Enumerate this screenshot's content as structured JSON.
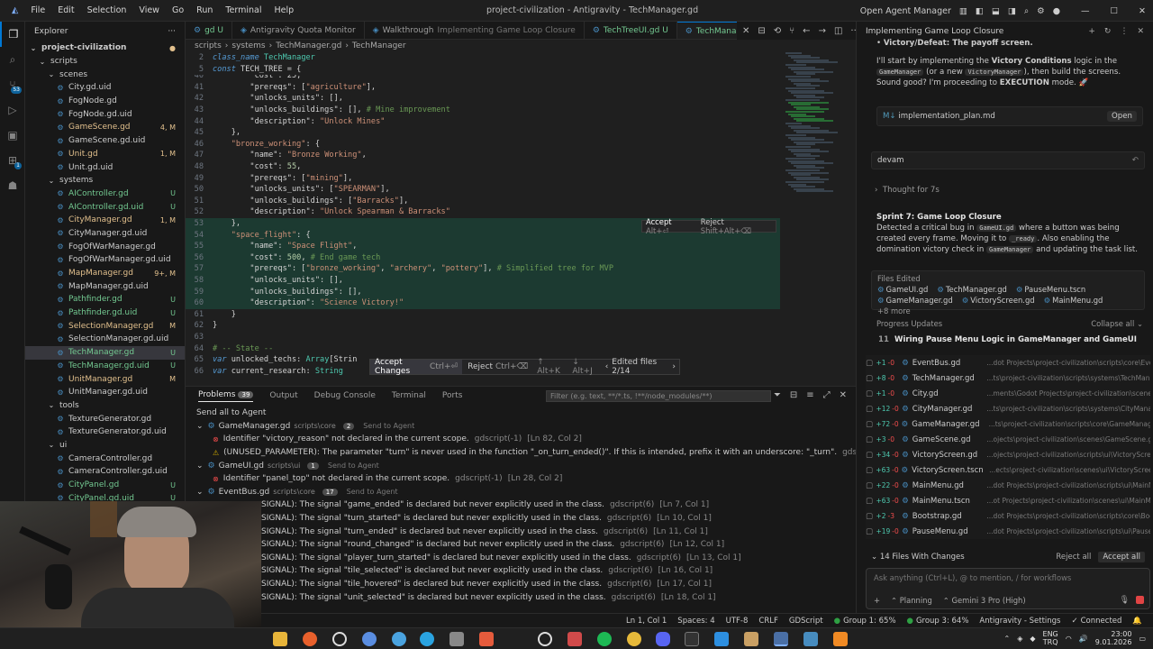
{
  "menu": [
    "File",
    "Edit",
    "Selection",
    "View",
    "Go",
    "Run",
    "Terminal",
    "Help"
  ],
  "window_title": "project-civilization - Antigravity - TechManager.gd",
  "open_agent_manager": "Open Agent Manager",
  "explorer": {
    "title": "Explorer",
    "root": "project-civilization",
    "items": [
      {
        "label": "scripts",
        "type": "folder",
        "indent": 1
      },
      {
        "label": "scenes",
        "type": "folder",
        "indent": 2
      },
      {
        "label": "City.gd.uid",
        "indent": 3
      },
      {
        "label": "FogNode.gd",
        "indent": 3
      },
      {
        "label": "FogNode.gd.uid",
        "indent": 3
      },
      {
        "label": "GameScene.gd",
        "indent": 3,
        "badge": "4, M",
        "color": "#e2c08d"
      },
      {
        "label": "GameScene.gd.uid",
        "indent": 3
      },
      {
        "label": "Unit.gd",
        "indent": 3,
        "badge": "1, M",
        "color": "#e2c08d"
      },
      {
        "label": "Unit.gd.uid",
        "indent": 3
      },
      {
        "label": "systems",
        "type": "folder",
        "indent": 2
      },
      {
        "label": "AIController.gd",
        "indent": 3,
        "badge": "U",
        "color": "#73c991"
      },
      {
        "label": "AIController.gd.uid",
        "indent": 3,
        "badge": "U",
        "color": "#73c991"
      },
      {
        "label": "CityManager.gd",
        "indent": 3,
        "badge": "1, M",
        "color": "#e2c08d"
      },
      {
        "label": "CityManager.gd.uid",
        "indent": 3
      },
      {
        "label": "FogOfWarManager.gd",
        "indent": 3
      },
      {
        "label": "FogOfWarManager.gd.uid",
        "indent": 3
      },
      {
        "label": "MapManager.gd",
        "indent": 3,
        "badge": "9+, M",
        "color": "#e2c08d"
      },
      {
        "label": "MapManager.gd.uid",
        "indent": 3
      },
      {
        "label": "Pathfinder.gd",
        "indent": 3,
        "badge": "U",
        "color": "#73c991"
      },
      {
        "label": "Pathfinder.gd.uid",
        "indent": 3,
        "badge": "U",
        "color": "#73c991"
      },
      {
        "label": "SelectionManager.gd",
        "indent": 3,
        "badge": "M",
        "color": "#e2c08d"
      },
      {
        "label": "SelectionManager.gd.uid",
        "indent": 3
      },
      {
        "label": "TechManager.gd",
        "indent": 3,
        "badge": "U",
        "color": "#73c991",
        "selected": true
      },
      {
        "label": "TechManager.gd.uid",
        "indent": 3,
        "badge": "U",
        "color": "#73c991"
      },
      {
        "label": "UnitManager.gd",
        "indent": 3,
        "badge": "M",
        "color": "#e2c08d"
      },
      {
        "label": "UnitManager.gd.uid",
        "indent": 3
      },
      {
        "label": "tools",
        "type": "folder",
        "indent": 2
      },
      {
        "label": "TextureGenerator.gd",
        "indent": 3
      },
      {
        "label": "TextureGenerator.gd.uid",
        "indent": 3
      },
      {
        "label": "ui",
        "type": "folder",
        "indent": 2
      },
      {
        "label": "CameraController.gd",
        "indent": 3
      },
      {
        "label": "CameraController.gd.uid",
        "indent": 3
      },
      {
        "label": "CityPanel.gd",
        "indent": 3,
        "badge": "U",
        "color": "#73c991"
      },
      {
        "label": "CityPanel.gd.uid",
        "indent": 3,
        "badge": "U",
        "color": "#73c991"
      }
    ]
  },
  "tabs": [
    {
      "label": "gd U",
      "color": "#73c991"
    },
    {
      "label": "Antigravity Quota Monitor"
    },
    {
      "label": "Walkthrough",
      "sub": "Implementing Game Loop Closure"
    },
    {
      "label": "TechTreeUI.gd U",
      "color": "#73c991"
    },
    {
      "label": "TechManager.gd U",
      "active": true,
      "color": "#73c991"
    }
  ],
  "breadcrumb": [
    "scripts",
    "systems",
    "TechManager.gd",
    "TechManager"
  ],
  "code": {
    "header": [
      {
        "n": "2",
        "parts": [
          [
            "kw",
            "class_name "
          ],
          [
            "cls",
            "TechManager"
          ]
        ]
      },
      {
        "n": "5",
        "parts": [
          [
            "kw",
            "const "
          ],
          [
            "txt",
            "TECH_TREE = {"
          ]
        ]
      }
    ],
    "lines": [
      {
        "n": "40",
        "parts": [
          [
            "txt",
            "        \"cost\": 25,"
          ]
        ]
      },
      {
        "n": "41",
        "parts": [
          [
            "txt",
            "        \"prereqs\": ["
          ],
          [
            "str",
            "\"agriculture\""
          ],
          [
            "txt",
            "],"
          ]
        ]
      },
      {
        "n": "42",
        "parts": [
          [
            "txt",
            "        \"unlocks_units\": [],"
          ]
        ]
      },
      {
        "n": "43",
        "parts": [
          [
            "txt",
            "        \"unlocks_buildings\": [], "
          ],
          [
            "cm",
            "# Mine improvement"
          ]
        ]
      },
      {
        "n": "44",
        "parts": [
          [
            "txt",
            "        \"description\": "
          ],
          [
            "str",
            "\"Unlock Mines\""
          ]
        ]
      },
      {
        "n": "45",
        "parts": [
          [
            "txt",
            "    },"
          ]
        ]
      },
      {
        "n": "46",
        "parts": [
          [
            "str",
            "    \"bronze_working\""
          ],
          [
            "txt",
            ": {"
          ]
        ]
      },
      {
        "n": "47",
        "parts": [
          [
            "txt",
            "        \"name\": "
          ],
          [
            "str",
            "\"Bronze Working\""
          ],
          [
            "txt",
            ","
          ]
        ]
      },
      {
        "n": "48",
        "parts": [
          [
            "txt",
            "        \"cost\": "
          ],
          [
            "num",
            "55"
          ],
          [
            "txt",
            ","
          ]
        ]
      },
      {
        "n": "49",
        "parts": [
          [
            "txt",
            "        \"prereqs\": ["
          ],
          [
            "str",
            "\"mining\""
          ],
          [
            "txt",
            "],"
          ]
        ]
      },
      {
        "n": "50",
        "parts": [
          [
            "txt",
            "        \"unlocks_units\": ["
          ],
          [
            "str",
            "\"SPEARMAN\""
          ],
          [
            "txt",
            "],"
          ]
        ]
      },
      {
        "n": "51",
        "parts": [
          [
            "txt",
            "        \"unlocks_buildings\": ["
          ],
          [
            "str",
            "\"Barracks\""
          ],
          [
            "txt",
            "],"
          ]
        ]
      },
      {
        "n": "52",
        "parts": [
          [
            "txt",
            "        \"description\": "
          ],
          [
            "str",
            "\"Unlock Spearman & Barracks\""
          ]
        ]
      },
      {
        "n": "53",
        "parts": [
          [
            "txt",
            "    },"
          ]
        ],
        "added": true
      },
      {
        "n": "54",
        "parts": [
          [
            "str",
            "    \"space_flight\""
          ],
          [
            "txt",
            ": {"
          ]
        ],
        "added": true
      },
      {
        "n": "55",
        "parts": [
          [
            "txt",
            "        \"name\": "
          ],
          [
            "str",
            "\"Space Flight\""
          ],
          [
            "txt",
            ","
          ]
        ],
        "added": true
      },
      {
        "n": "56",
        "parts": [
          [
            "txt",
            "        \"cost\": "
          ],
          [
            "num",
            "500"
          ],
          [
            "txt",
            ", "
          ],
          [
            "cm",
            "# End game tech"
          ]
        ],
        "added": true
      },
      {
        "n": "57",
        "parts": [
          [
            "txt",
            "        \"prereqs\": ["
          ],
          [
            "str",
            "\"bronze_working\""
          ],
          [
            "txt",
            ", "
          ],
          [
            "str",
            "\"archery\""
          ],
          [
            "txt",
            ", "
          ],
          [
            "str",
            "\"pottery\""
          ],
          [
            "txt",
            "], "
          ],
          [
            "cm",
            "# Simplified tree for MVP"
          ]
        ],
        "added": true
      },
      {
        "n": "58",
        "parts": [
          [
            "txt",
            "        \"unlocks_units\": [],"
          ]
        ],
        "added": true
      },
      {
        "n": "59",
        "parts": [
          [
            "txt",
            "        \"unlocks_buildings\": [],"
          ]
        ],
        "added": true
      },
      {
        "n": "60",
        "parts": [
          [
            "txt",
            "        \"description\": "
          ],
          [
            "str",
            "\"Science Victory!\""
          ]
        ],
        "added": true
      },
      {
        "n": "61",
        "parts": [
          [
            "txt",
            "    }"
          ]
        ]
      },
      {
        "n": "62",
        "parts": [
          [
            "txt",
            "}"
          ]
        ]
      },
      {
        "n": "63",
        "parts": [
          [
            "txt",
            ""
          ]
        ]
      },
      {
        "n": "64",
        "parts": [
          [
            "cm",
            "# -- State --"
          ]
        ]
      },
      {
        "n": "65",
        "parts": [
          [
            "kw",
            "var "
          ],
          [
            "txt",
            "unlocked_techs: "
          ],
          [
            "cls",
            "Array"
          ],
          [
            "txt",
            "[Strin"
          ]
        ]
      },
      {
        "n": "66",
        "parts": [
          [
            "kw",
            "var "
          ],
          [
            "txt",
            "current_research: "
          ],
          [
            "cls",
            "String"
          ]
        ]
      }
    ]
  },
  "inline_accept": {
    "accept": "Accept",
    "accept_key": "Alt+⏎",
    "reject": "Reject",
    "reject_key": "Shift+Alt+⌫"
  },
  "accept_bar": {
    "accept": "Accept Changes",
    "accept_key": "Ctrl+⏎",
    "reject": "Reject",
    "reject_key": "Ctrl+⌫",
    "prev_key": "Alt+K",
    "next_key": "Alt+J",
    "edited": "Edited files 2/14"
  },
  "panel": {
    "tabs": [
      {
        "label": "Problems",
        "count": "39"
      },
      {
        "label": "Output"
      },
      {
        "label": "Debug Console"
      },
      {
        "label": "Terminal"
      },
      {
        "label": "Ports"
      }
    ],
    "filter_placeholder": "Filter (e.g. text, **/*.ts, !**/node_modules/**)",
    "send_all": "Send all to Agent",
    "groups": [
      {
        "file": "GameManager.gd",
        "path": "scripts\\core",
        "count": "2",
        "send": "Send to Agent"
      },
      {
        "file": "GameUI.gd",
        "path": "scripts\\ui",
        "count": "1",
        "send": "Send to Agent"
      },
      {
        "file": "EventBus.gd",
        "path": "scripts\\core",
        "count": "17",
        "send": "Send to Agent"
      }
    ],
    "rows": [
      {
        "text": "Identifier \"victory_reason\" not declared in the current scope.",
        "src": "gdscript(-1)",
        "loc": "[Ln 82, Col 2]",
        "group": 0
      },
      {
        "text": "(UNUSED_PARAMETER): The parameter \"turn\" is never used in the function \"_on_turn_ended()\". If this is intended, prefix it with an underscore: \"_turn\".",
        "src": "gdscript(5)",
        "loc": "[Ln 51, Col 1]",
        "group": 0
      },
      {
        "text": "Identifier \"panel_top\" not declared in the current scope.",
        "src": "gdscript(-1)",
        "loc": "[Ln 28, Col 2]",
        "group": 1
      },
      {
        "text": "SIGNAL): The signal \"game_ended\" is declared but never explicitly used in the class.",
        "src": "gdscript(6)",
        "loc": "[Ln 7, Col 1]"
      },
      {
        "text": "SIGNAL): The signal \"turn_started\" is declared but never explicitly used in the class.",
        "src": "gdscript(6)",
        "loc": "[Ln 10, Col 1]"
      },
      {
        "text": "SIGNAL): The signal \"turn_ended\" is declared but never explicitly used in the class.",
        "src": "gdscript(6)",
        "loc": "[Ln 11, Col 1]"
      },
      {
        "text": "SIGNAL): The signal \"round_changed\" is declared but never explicitly used in the class.",
        "src": "gdscript(6)",
        "loc": "[Ln 12, Col 1]"
      },
      {
        "text": "SIGNAL): The signal \"player_turn_started\" is declared but never explicitly used in the class.",
        "src": "gdscript(6)",
        "loc": "[Ln 13, Col 1]"
      },
      {
        "text": "SIGNAL): The signal \"tile_selected\" is declared but never explicitly used in the class.",
        "src": "gdscript(6)",
        "loc": "[Ln 16, Col 1]"
      },
      {
        "text": "SIGNAL): The signal \"tile_hovered\" is declared but never explicitly used in the class.",
        "src": "gdscript(6)",
        "loc": "[Ln 17, Col 1]"
      },
      {
        "text": "SIGNAL): The signal \"unit_selected\" is declared but never explicitly used in the class.",
        "src": "gdscript(6)",
        "loc": "[Ln 18, Col 1]"
      }
    ]
  },
  "status": [
    "Ln 1, Col 1",
    "Spaces: 4",
    "UTF-8",
    "CRLF",
    "GDScript",
    "Group 1: 65%",
    "Group 3: 64%",
    "Antigravity - Settings",
    "Connected"
  ],
  "agent": {
    "title": "Implementing Game Loop Closure",
    "victory_line": "Victory/Defeat: The payoff screen.",
    "intro_a": "I'll start by implementing the ",
    "intro_b": "Victory Conditions",
    "intro_c": " logic in the ",
    "intro_code": "GameManager",
    "intro_d": " (or a new ",
    "intro_code2": "VictoryManager",
    "intro_e": "), then build the screens.",
    "intro_f": "Sound good? I'm proceeding to ",
    "intro_g": "EXECUTION",
    "intro_h": " mode. 🚀",
    "plan_file": "implementation_plan.md",
    "plan_open": "Open",
    "user_msg": "devam",
    "thought": "Thought for 7s",
    "sprint_title": "Sprint 7: Game Loop Closure",
    "sprint_text_a": "Detected a critical bug in ",
    "sprint_code": "GameUI.gd",
    "sprint_text_b": " where a button was being created every frame. Moving it to ",
    "sprint_code2": "_ready",
    "sprint_text_c": ". Also enabling the domination victory check in ",
    "sprint_code3": "GameManager",
    "sprint_text_d": " and updating the task list.",
    "files_edited": "Files Edited",
    "files": [
      "GameUI.gd",
      "TechManager.gd",
      "PauseMenu.tscn",
      "GameManager.gd",
      "VictoryScreen.gd",
      "MainMenu.gd"
    ],
    "more": "+8 more",
    "progress": "Progress Updates",
    "collapse": "Collapse all",
    "step_num": "11",
    "step_title": "Wiring Pause Menu Logic in GameManager and GameUI",
    "changes": [
      {
        "plus": "+1",
        "minus": "-0",
        "file": "EventBus.gd",
        "path": "...dot Projects\\project-civilization\\scripts\\core\\EventBus.gd"
      },
      {
        "plus": "+8",
        "minus": "-0",
        "file": "TechManager.gd",
        "path": "...ts\\project-civilization\\scripts\\systems\\TechManager.gd"
      },
      {
        "plus": "+1",
        "minus": "-0",
        "file": "City.gd",
        "path": "...ments\\Godot Projects\\project-civilization\\scenes\\City.gd"
      },
      {
        "plus": "+12",
        "minus": "-0",
        "file": "CityManager.gd",
        "path": "...ts\\project-civilization\\scripts\\systems\\CityManager.gd"
      },
      {
        "plus": "+72",
        "minus": "-0",
        "file": "GameManager.gd",
        "path": "...ts\\project-civilization\\scripts\\core\\GameManager.gd"
      },
      {
        "plus": "+3",
        "minus": "-0",
        "file": "GameScene.gd",
        "path": "...ojects\\project-civilization\\scenes\\GameScene.gd"
      },
      {
        "plus": "+34",
        "minus": "-0",
        "file": "VictoryScreen.gd",
        "path": "...ojects\\project-civilization\\scripts\\ui\\VictoryScreen.gd"
      },
      {
        "plus": "+63",
        "minus": "-0",
        "file": "VictoryScreen.tscn",
        "path": "...ects\\project-civilization\\scenes\\ui\\VictoryScreen.tscn"
      },
      {
        "plus": "+22",
        "minus": "-0",
        "file": "MainMenu.gd",
        "path": "...dot Projects\\project-civilization\\scripts\\ui\\MainMenu.gd"
      },
      {
        "plus": "+63",
        "minus": "-0",
        "file": "MainMenu.tscn",
        "path": "...ot Projects\\project-civilization\\scenes\\ui\\MainMenu.tscn"
      },
      {
        "plus": "+2",
        "minus": "-3",
        "file": "Bootstrap.gd",
        "path": "...dot Projects\\project-civilization\\scripts\\core\\Bootstrap.gd"
      },
      {
        "plus": "+19",
        "minus": "-0",
        "file": "PauseMenu.gd",
        "path": "...dot Projects\\project-civilization\\scripts\\ui\\PauseMenu.gd"
      }
    ],
    "files_with_changes": "14 Files With Changes",
    "reject_all": "Reject all",
    "accept_all": "Accept all",
    "input_placeholder": "Ask anything (Ctrl+L), @ to mention, / for workflows",
    "mode": "Planning",
    "model": "Gemini 3 Pro (High)"
  },
  "tray": {
    "lang": "ENG",
    "layout": "TRQ",
    "time": "23:00",
    "date": "9.01.2026"
  },
  "colors": {
    "accent": "#0078d4",
    "added_bg": "#1c3a31",
    "modified": "#e2c08d",
    "untracked": "#73c991",
    "error": "#f14c4c"
  }
}
